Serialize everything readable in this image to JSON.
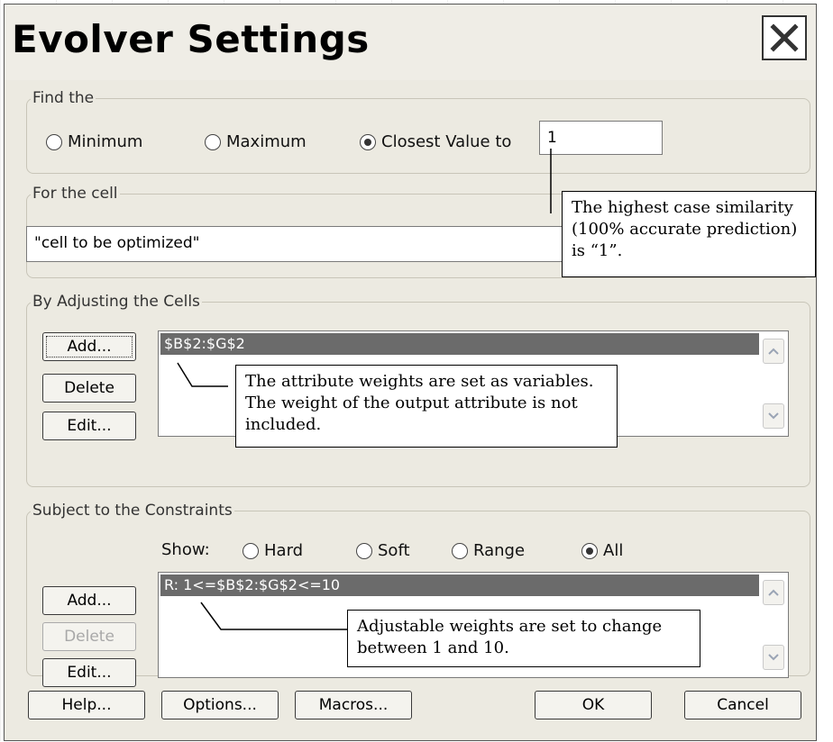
{
  "window": {
    "title": "Evolver Settings"
  },
  "find": {
    "legend": "Find the",
    "minimum": "Minimum",
    "maximum": "Maximum",
    "closest": "Closest Value to",
    "closest_value": "1",
    "selected": "closest"
  },
  "cell": {
    "legend": "For the cell",
    "value": "\"cell to be optimized\""
  },
  "adjusting": {
    "legend": "By Adjusting the Cells",
    "add": "Add...",
    "delete": "Delete",
    "edit": "Edit...",
    "items": [
      "$B$2:$G$2"
    ]
  },
  "constraints": {
    "legend": "Subject to the Constraints",
    "show_label": "Show:",
    "hard": "Hard",
    "soft": "Soft",
    "range": "Range",
    "all": "All",
    "selected": "all",
    "add": "Add...",
    "delete": "Delete",
    "edit": "Edit...",
    "items": [
      "R: 1<=$B$2:$G$2<=10"
    ]
  },
  "footer": {
    "help": "Help...",
    "options": "Options...",
    "macros": "Macros...",
    "ok": "OK",
    "cancel": "Cancel"
  },
  "annotations": {
    "closest_note": "The highest case similarity (100% accurate prediction) is “1”.",
    "cells_note": "The attribute weights are set as variables.  The weight of the output attribute is not included.",
    "constraints_note": "Adjustable weights are set to change between 1 and 10."
  }
}
